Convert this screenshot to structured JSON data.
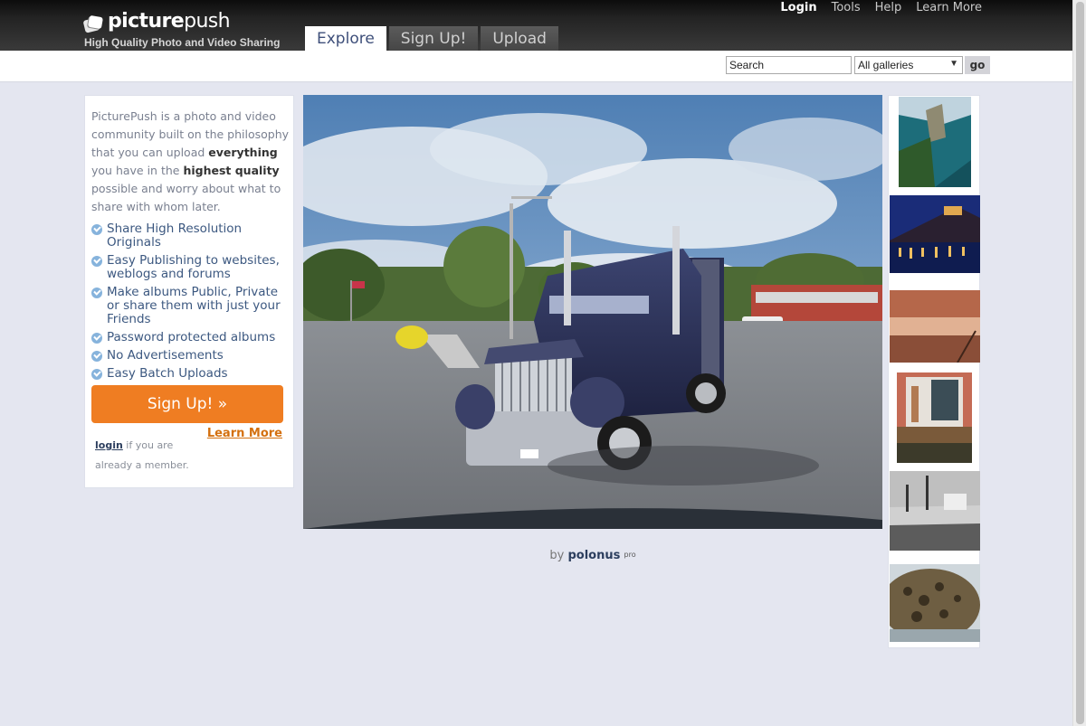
{
  "header": {
    "logo_text_bold": "picture",
    "logo_text_light": "push",
    "tagline": "High Quality Photo and Video Sharing",
    "topnav": [
      "Login",
      "Tools",
      "Help",
      "Learn More"
    ],
    "tabs": [
      {
        "label": "Explore",
        "active": true
      },
      {
        "label": "Sign Up!",
        "active": false
      },
      {
        "label": "Upload",
        "active": false
      }
    ]
  },
  "search": {
    "value": "Search",
    "gallery_selected": "All galleries",
    "go_label": "go"
  },
  "sidebar": {
    "intro_1": "PicturePush is a photo and video community built on the philosophy that you can upload ",
    "intro_b1": "everything",
    "intro_2": " you have in the ",
    "intro_b2": "highest quality",
    "intro_3": " possible and worry about what to share with whom later.",
    "features": [
      "Share High Resolution Originals",
      "Easy Publishing to websites, weblogs and forums",
      "Make albums Public, Private or share them with just your Friends",
      "Password protected albums",
      "No Advertisements",
      "Easy Batch Uploads"
    ],
    "signup_label": "Sign Up! »",
    "learn_more_label": "Learn More",
    "login_link": "login",
    "login_note": " if you are already a member."
  },
  "photo": {
    "by": "by ",
    "author": "polonus",
    "pro_badge": "pro"
  },
  "colors": {
    "accent_orange": "#ef7d22",
    "link_blue": "#2c3e5e",
    "page_bg": "#e4e6f0"
  }
}
